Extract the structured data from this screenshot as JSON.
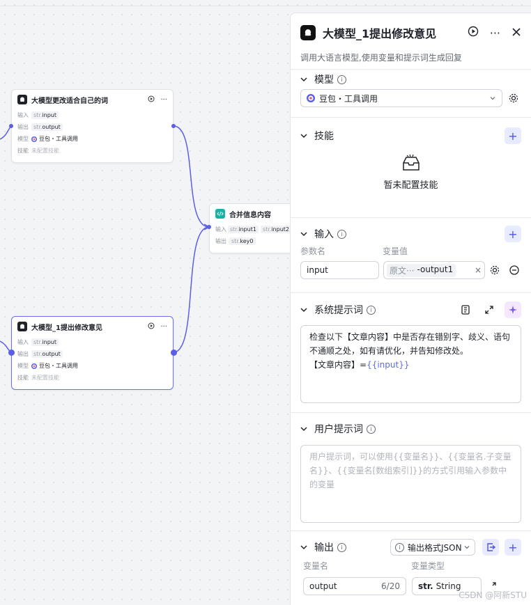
{
  "nodes": {
    "node_a": {
      "title": "大模型更改适合自己的词",
      "input_label": "输入",
      "input_type": "str.",
      "input_name": "input",
      "output_label": "输出",
      "output_type": "str.",
      "output_name": "output",
      "model_label": "模型",
      "model_value": "豆包・工具调用",
      "skill_label": "技能",
      "skill_value": "未配置技能"
    },
    "node_b": {
      "title": "合并信息内容",
      "input_label": "输入",
      "input_type1": "str.",
      "input_name1": "input1",
      "input_type2": "str.",
      "input_name2": "input2",
      "output_label": "输出",
      "output_type": "str.",
      "output_name": "key0"
    },
    "node_c": {
      "title": "大模型_1提出修改意见",
      "input_label": "输入",
      "input_type": "str.",
      "input_name": "input",
      "output_label": "输出",
      "output_type": "str.",
      "output_name": "output",
      "model_label": "模型",
      "model_value": "豆包・工具调用",
      "skill_label": "技能",
      "skill_value": "未配置技能"
    }
  },
  "panel": {
    "title": "大模型_1提出修改意见",
    "description": "调用大语言模型,使用变量和提示词生成回复",
    "model": {
      "title": "模型",
      "selected": "豆包・工具调用"
    },
    "skills": {
      "title": "技能",
      "empty": "暂未配置技能"
    },
    "inputs": {
      "title": "输入",
      "param_label": "参数名",
      "value_label": "变量值",
      "param_value": "input",
      "var_prefix": "原文···",
      "var_value": "-output1"
    },
    "system_prompt": {
      "title": "系统提示词",
      "line1": "检查以下【文章内容】中是否存在错别字、歧义、语句",
      "line2": "不通顺之处，如有请优化，并告知修改处。",
      "line3_prefix": "【文章内容】=",
      "line3_var": "{{input}}"
    },
    "user_prompt": {
      "title": "用户提示词",
      "placeholder": "用户提示词，可以使用{{变量名}}、{{变量名.子变量名}}、{{变量名[数组索引]}}的方式引用输入参数中的变量"
    },
    "output": {
      "title": "输出",
      "format": "输出格式JSON",
      "var_name_label": "变量名",
      "var_type_label": "变量类型",
      "var_name": "output",
      "var_count": "6/20",
      "type_prefix": "str.",
      "type_value": "String"
    }
  },
  "watermark": "CSDN @阿新STU",
  "colors": {
    "accent": "#5a5fe6",
    "teal": "#17b4a6"
  }
}
